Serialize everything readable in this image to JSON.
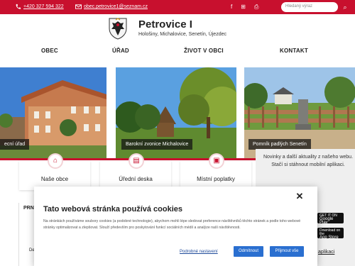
{
  "topbar": {
    "phone": "+420 327 594 322",
    "email": "obec.petrovice1@seznam.cz",
    "search_placeholder": "Hledaný výraz"
  },
  "header": {
    "title": "Petrovice I",
    "subtitle": "Hološiny, Michalovice, Senetín, Újezdec"
  },
  "nav": {
    "obec": "OBEC",
    "urad": "ÚŘAD",
    "zivot": "ŽIVOT V OBCI",
    "kontakt": "KONTAKT"
  },
  "photos": [
    {
      "caption": "ecní úřad"
    },
    {
      "caption": "Barokní zvonice Michalovice"
    },
    {
      "caption": "Pomník padlých Senetín"
    }
  ],
  "quicklinks": [
    {
      "label": "Naše obce"
    },
    {
      "label": "Úřední deska"
    },
    {
      "label": "Místní poplatky"
    }
  ],
  "right_panel": {
    "text": "Novinky a další aktuality z našeho webu. Stačí si stáhnout mobilní aplikaci.",
    "google_play_small": "GET IT ON",
    "google_play": "Google Play",
    "app_store_small": "Download on the",
    "app_store": "App Store",
    "link": "aplikaci"
  },
  "left_partial": {
    "title": "PRN",
    "text": "De"
  },
  "cookie": {
    "title": "Tato webová stránka používá cookies",
    "body": "Na stránkách používáme soubory cookies (a podobné technologie), abychom mohli lépe sledovat preference návštěvníků těchto stránek a podle toho webové stránky optimalizovat a zlepšovat. Slouží především pro poskytování funkcí sociálních médií a analýze naší návštěvnosti.",
    "settings_link": "Podrobné nastavení",
    "reject": "Odmítnout",
    "accept": "Přijmout vše"
  },
  "colors": {
    "brand": "#c8102e",
    "button": "#2a6fd0"
  }
}
